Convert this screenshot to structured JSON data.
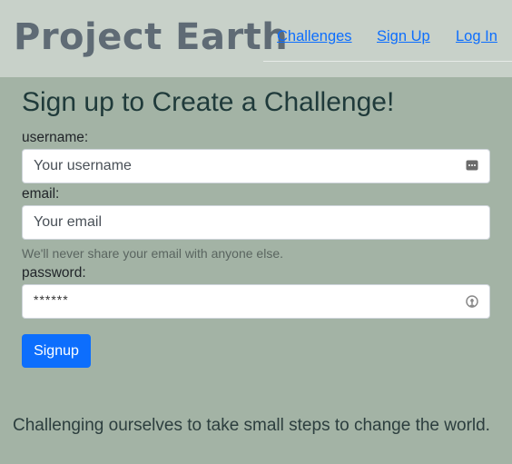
{
  "header": {
    "logo": "Project Earth",
    "nav": [
      "Challenges",
      "Sign Up",
      "Log In"
    ]
  },
  "form": {
    "title": "Sign up to Create a Challenge!",
    "username_label": "username:",
    "username_placeholder": "Your username",
    "email_label": "email:",
    "email_placeholder": "Your email",
    "email_help": "We'll never share your email with anyone else.",
    "password_label": "password:",
    "password_value": "******",
    "submit_label": "Signup"
  },
  "tagline": "Challenging ourselves to take small steps to change the world.",
  "colors": {
    "page_bg": "#a3b3a5",
    "header_bg": "#c8d1c9",
    "link": "#0d6efd",
    "button": "#0d6efd"
  }
}
